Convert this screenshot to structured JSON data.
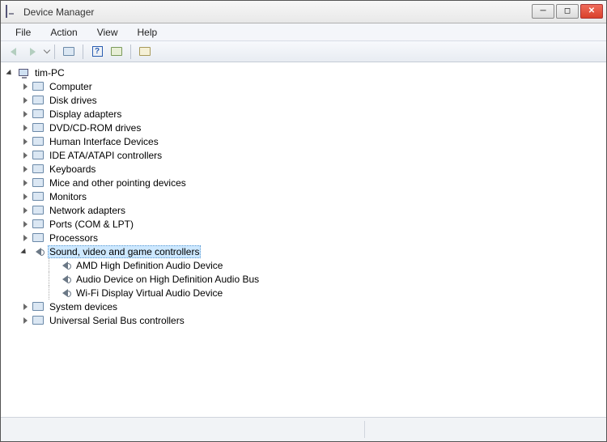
{
  "window": {
    "title": "Device Manager"
  },
  "menu": {
    "items": [
      "File",
      "Action",
      "View",
      "Help"
    ]
  },
  "tree": {
    "root": "tim-PC",
    "categories": [
      {
        "label": "Computer",
        "expanded": false
      },
      {
        "label": "Disk drives",
        "expanded": false
      },
      {
        "label": "Display adapters",
        "expanded": false
      },
      {
        "label": "DVD/CD-ROM drives",
        "expanded": false
      },
      {
        "label": "Human Interface Devices",
        "expanded": false
      },
      {
        "label": "IDE ATA/ATAPI controllers",
        "expanded": false
      },
      {
        "label": "Keyboards",
        "expanded": false
      },
      {
        "label": "Mice and other pointing devices",
        "expanded": false
      },
      {
        "label": "Monitors",
        "expanded": false
      },
      {
        "label": "Network adapters",
        "expanded": false
      },
      {
        "label": "Ports (COM & LPT)",
        "expanded": false
      },
      {
        "label": "Processors",
        "expanded": false
      },
      {
        "label": "Sound, video and game controllers",
        "expanded": true,
        "selected": true,
        "children": [
          "AMD High Definition Audio Device",
          "Audio Device on High Definition Audio Bus",
          "Wi-Fi Display Virtual Audio Device"
        ]
      },
      {
        "label": "System devices",
        "expanded": false
      },
      {
        "label": "Universal Serial Bus controllers",
        "expanded": false
      }
    ]
  }
}
